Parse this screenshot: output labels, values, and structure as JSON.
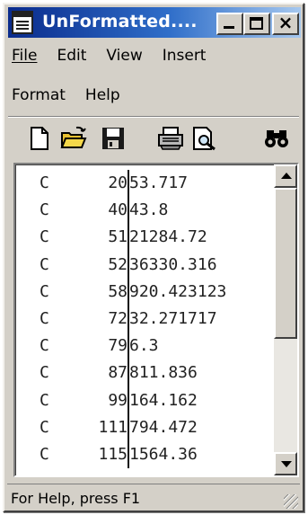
{
  "window": {
    "title": "UnFormatted....",
    "controls": {
      "minimize": "_",
      "close": "×"
    }
  },
  "menu": {
    "row1": [
      {
        "label": "File"
      },
      {
        "label": "Edit"
      },
      {
        "label": "View"
      },
      {
        "label": "Insert"
      }
    ],
    "row2": [
      {
        "label": "Format"
      },
      {
        "label": "Help"
      }
    ]
  },
  "toolbar": {
    "buttons": [
      "new-document-icon",
      "open-folder-icon",
      "save-disk-icon",
      "print-icon",
      "print-preview-icon",
      "find-binoculars-icon"
    ]
  },
  "editor": {
    "lines": [
      {
        "c": "C",
        "n": "20",
        "v": "53.717"
      },
      {
        "c": "C",
        "n": "40",
        "v": "43.8"
      },
      {
        "c": "C",
        "n": "51",
        "v": "21284.72"
      },
      {
        "c": "C",
        "n": "52",
        "v": "36330.316"
      },
      {
        "c": "C",
        "n": "58",
        "v": "920.423123"
      },
      {
        "c": "C",
        "n": "72",
        "v": "32.271717"
      },
      {
        "c": "C",
        "n": "79",
        "v": "6.3"
      },
      {
        "c": "C",
        "n": "87",
        "v": "811.836"
      },
      {
        "c": "C",
        "n": "99",
        "v": "164.162"
      },
      {
        "c": "C",
        "n": "111",
        "v": "794.472"
      },
      {
        "c": "C",
        "n": "115",
        "v": "1564.36"
      }
    ]
  },
  "statusbar": {
    "text": "For Help, press F1"
  }
}
